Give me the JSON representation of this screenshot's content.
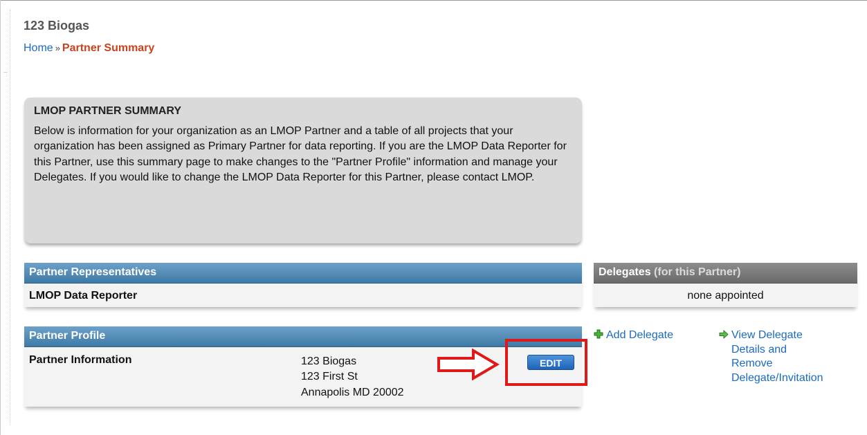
{
  "header": {
    "site_title": "123 Biogas",
    "breadcrumb": {
      "home": "Home",
      "separator": "»",
      "current": "Partner Summary"
    }
  },
  "summary": {
    "heading": "LMOP PARTNER SUMMARY",
    "body": "Below is information for your organization as an LMOP Partner and a table of all projects that your organization has been assigned as Primary Partner for data reporting. If you are the LMOP Data Reporter for this Partner, use this summary page to make changes to the \"Partner Profile\" information and manage your Delegates. If you would like to change the LMOP Data Reporter for this Partner, please contact LMOP."
  },
  "representatives": {
    "title": "Partner Representatives",
    "data_reporter_label": "LMOP Data Reporter"
  },
  "delegates": {
    "title": "Delegates",
    "title_suffix": "(for this Partner)",
    "status": "none appointed",
    "add_link": "Add Delegate",
    "view_link_lines": [
      "View Delegate",
      "Details and",
      "Remove",
      "Delegate/Invitation"
    ]
  },
  "profile": {
    "title": "Partner Profile",
    "info_label": "Partner Information",
    "address_lines": [
      "123 Biogas",
      "123 First St",
      "Annapolis MD 20002"
    ],
    "edit_button": "EDIT"
  },
  "annotation": {
    "arrow_icon": "right-arrow-icon",
    "highlight_color": "#e01818"
  },
  "colors": {
    "link": "#1a6bbf",
    "breadcrumb_current": "#c8431e",
    "panel_header_blue": "#4a86b3",
    "panel_header_gray": "#7a7a7a",
    "icon_green": "#3aa52a"
  }
}
